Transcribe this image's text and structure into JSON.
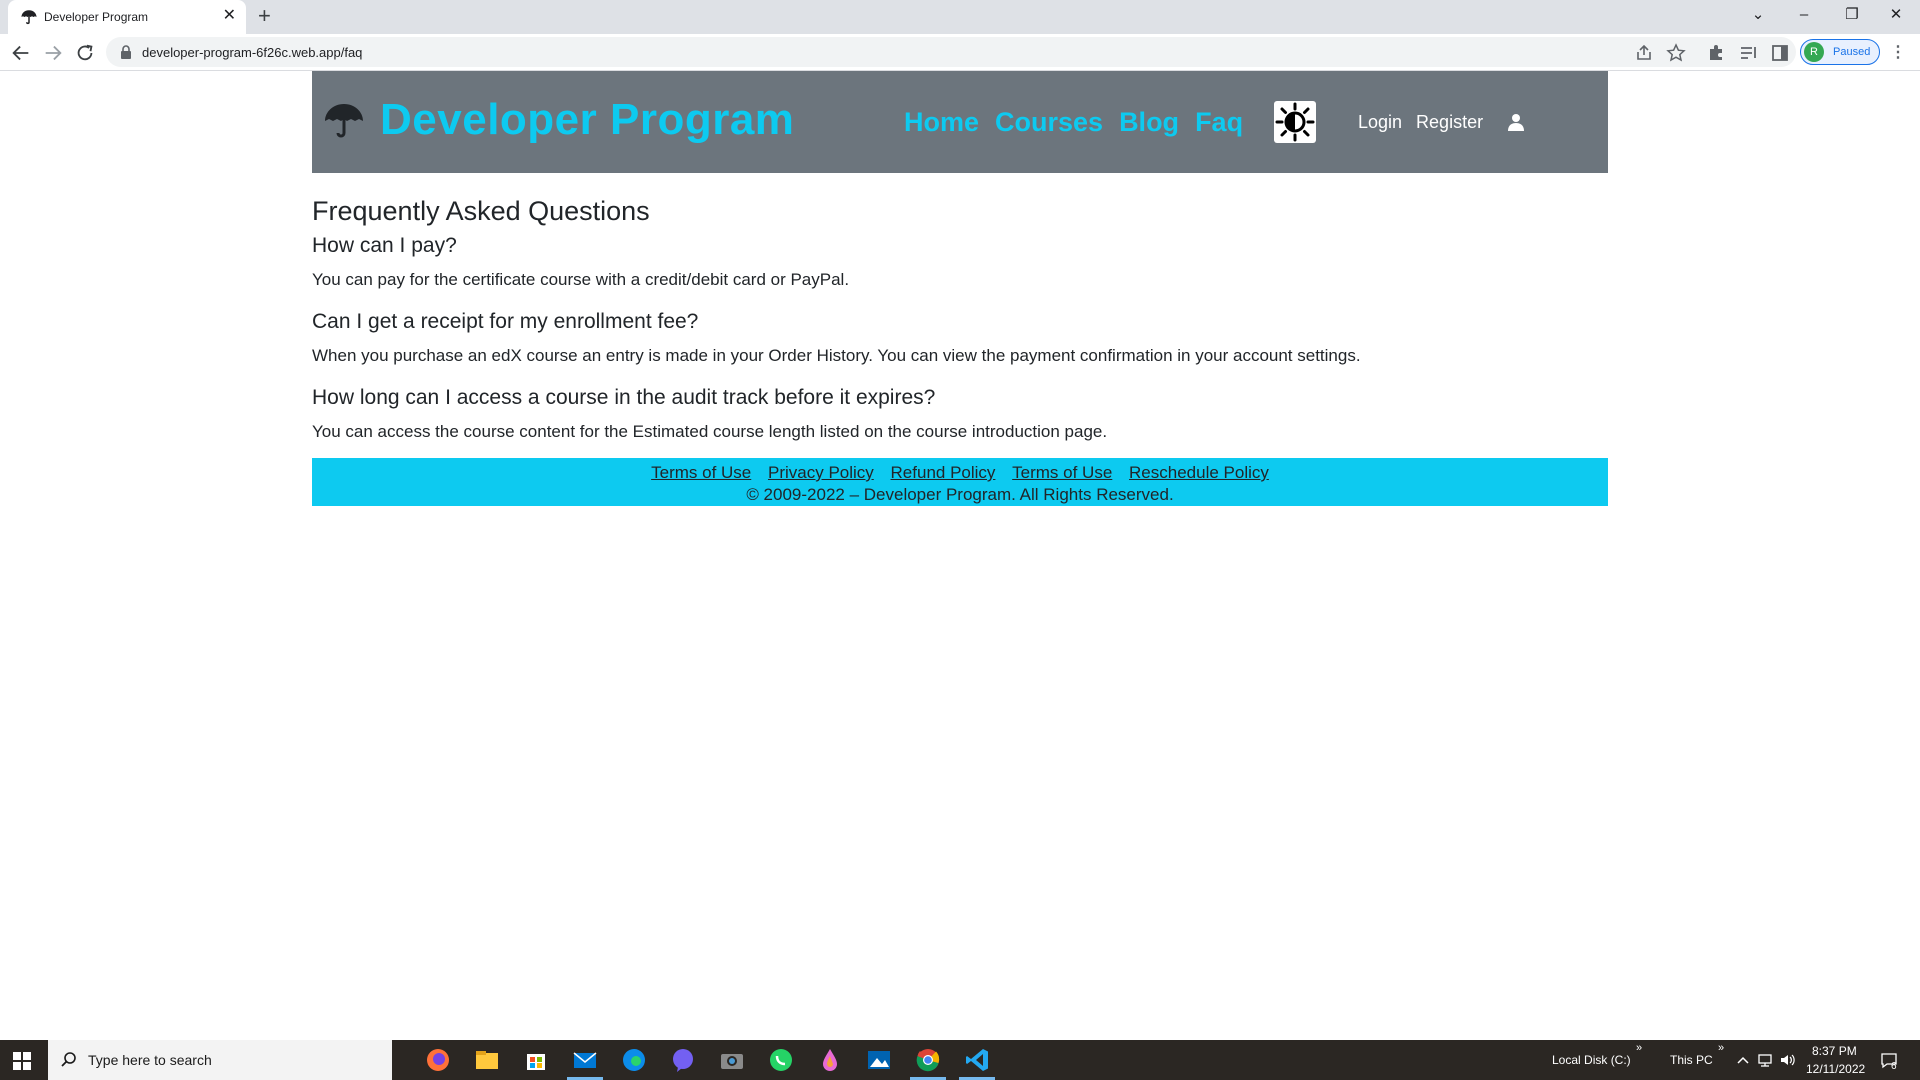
{
  "browser": {
    "tab_title": "Developer Program",
    "url": "developer-program-6f26c.web.app/faq",
    "profile_initial": "R",
    "profile_label": "Paused"
  },
  "header": {
    "brand": "Developer Program",
    "nav": [
      "Home",
      "Courses",
      "Blog",
      "Faq"
    ],
    "login": "Login",
    "register": "Register"
  },
  "faq": {
    "title": "Frequently Asked Questions",
    "items": [
      {
        "question": "How can I pay?",
        "answer": "You can pay for the certificate course with a credit/debit card or PayPal."
      },
      {
        "question": "Can I get a receipt for my enrollment fee?",
        "answer": "When you purchase an edX course an entry is made in your Order History. You can view the payment confirmation in your account settings."
      },
      {
        "question": "How long can I access a course in the audit track before it expires?",
        "answer": "You can access the course content for the Estimated course length listed on the course introduction page."
      }
    ]
  },
  "footer": {
    "links": [
      "Terms of Use",
      "Privacy Policy",
      "Refund Policy",
      "Terms of Use",
      "Reschedule Policy"
    ],
    "copyright": "© 2009-2022 – Developer Program. All Rights Reserved."
  },
  "taskbar": {
    "search_placeholder": "Type here to search",
    "local_disk": "Local Disk (C:)",
    "this_pc": "This PC",
    "time": "8:37 PM",
    "date": "12/11/2022",
    "notifications": "6"
  },
  "colors": {
    "accent": "#0dcaf0",
    "header_bg": "#6c757d",
    "taskbar_bg": "#2b2723"
  }
}
